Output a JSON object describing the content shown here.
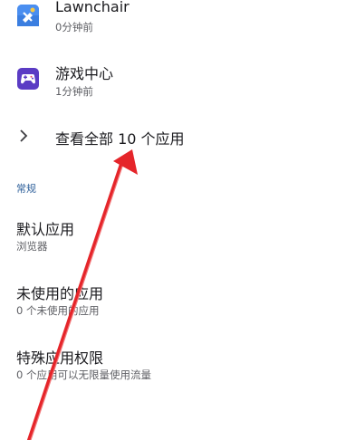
{
  "apps": [
    {
      "name": "Lawnchair",
      "time": "0分钟前",
      "icon": "lawnchair-icon",
      "color": "#4a8ef0"
    },
    {
      "name": "游戏中心",
      "time": "1分钟前",
      "icon": "gamepad-icon",
      "color": "#5b3cc4"
    }
  ],
  "see_all": {
    "label": "查看全部 10 个应用",
    "icon": "chevron-right-icon"
  },
  "section": {
    "label": "常规"
  },
  "settings": [
    {
      "title": "默认应用",
      "subtitle": "浏览器"
    },
    {
      "title": "未使用的应用",
      "subtitle": "0 个未使用的应用"
    },
    {
      "title": "特殊应用权限",
      "subtitle": "0 个应用可以无限量使用流量"
    }
  ],
  "annotation": {
    "icon": "red-arrow-annotation",
    "color": "#e5252a"
  }
}
